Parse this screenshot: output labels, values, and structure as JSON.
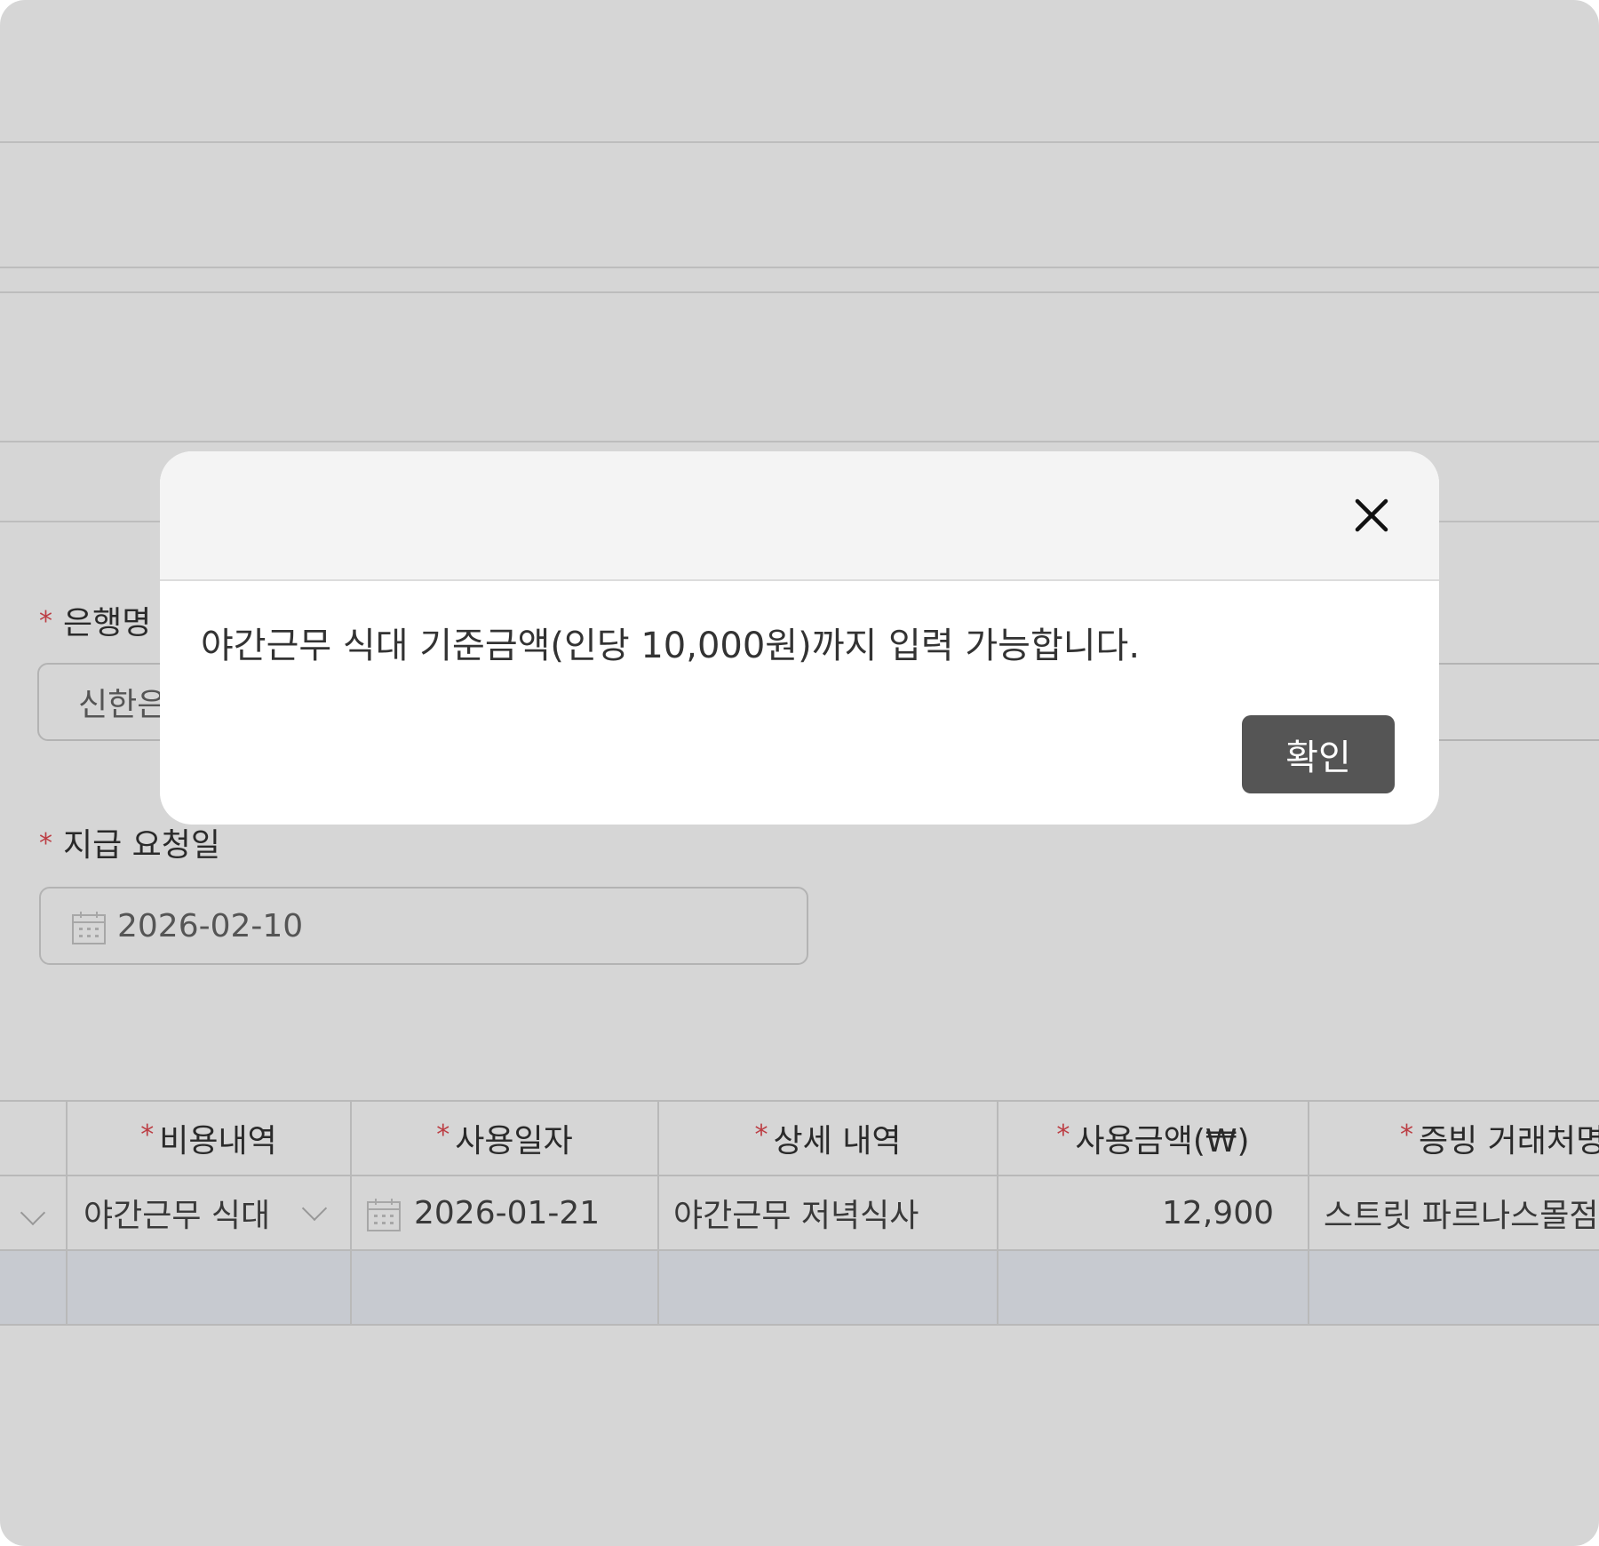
{
  "form": {
    "bank_label": "은행명",
    "bank_value": "신한은",
    "date_label": "지급 요청일",
    "date_value": "2026-02-10",
    "required_mark": "*"
  },
  "table": {
    "columns": [
      "비용내역",
      "사용일자",
      "상세 내역",
      "사용금액(₩)",
      "증빙 거래처명"
    ],
    "rows": [
      {
        "expense_type": "야간근무 식대",
        "date": "2026-01-21",
        "detail": "야간근무 저녁식사",
        "amount": "12,900",
        "vendor": "스트릿 파르나스몰점"
      }
    ]
  },
  "dialog": {
    "message": "야간근무 식대 기준금액(인당 10,000원)까지 입력 가능합니다.",
    "confirm_label": "확인",
    "close_icon": "close-icon"
  },
  "colors": {
    "required": "#e14a52",
    "confirm_button": "#555555",
    "dialog_header": "#f4f4f4"
  }
}
